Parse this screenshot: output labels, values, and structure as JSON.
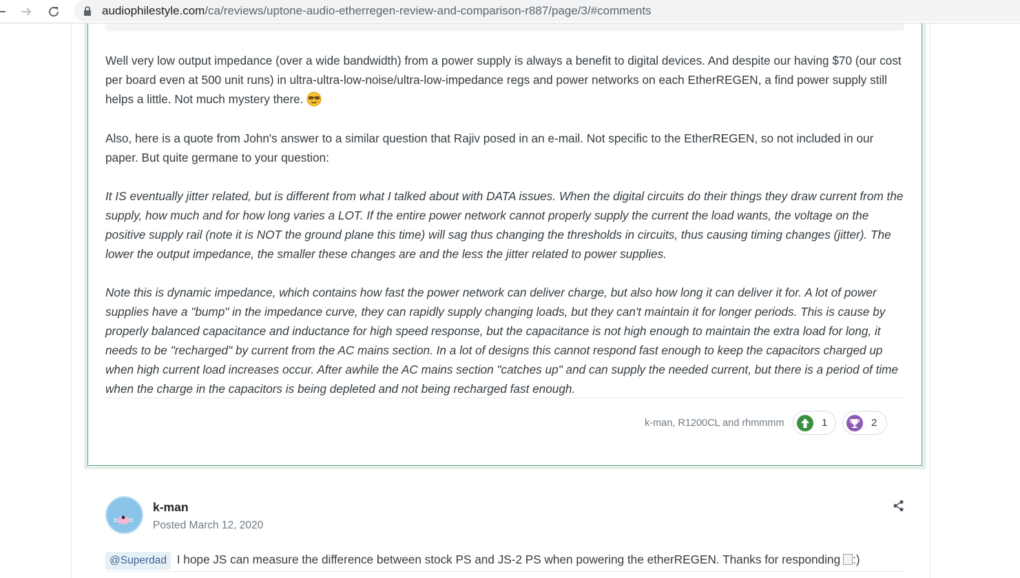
{
  "browser": {
    "url_domain": "audiophilestyle.com",
    "url_path": "/ca/reviews/uptone-audio-etherregen-review-and-comparison-r887/page/3/#comments"
  },
  "post": {
    "paragraph1": "Well very low output impedance (over a wide bandwidth) from a power supply is always a benefit to digital devices.  And despite our having $70 (our cost per board even at 500 unit runs) in ultra-ultra-low-noise/ultra-low-impedance regs and power networks on each EtherREGEN, a find power supply still helps a little.  Not much mystery there.",
    "paragraph2": "Also, here is a quote from John's answer to a similar question that Rajiv posed in an e-mail. Not specific to the EtherREGEN, so not included in our paper.  But quite germane to your question:",
    "quote1": "It IS eventually jitter related, but is different from what I talked about with DATA issues. When the digital circuits do their things they draw current from the supply, how much and for how long varies a LOT. If the entire power network cannot properly supply the current the load wants, the voltage on the positive supply rail (note it is NOT the ground plane this time) will sag thus changing the thresholds in circuits, thus causing timing changes (jitter). The lower the output impedance, the smaller these changes are and the less the jitter related to power supplies.",
    "quote2": "Note this is dynamic impedance, which contains how fast the power network can deliver charge, but also how long it can deliver it for. A lot of power supplies have a \"bump\" in the impedance curve, they can rapidly supply changing loads, but they can't maintain it for longer periods. This is cause by properly balanced capacitance and inductance for high speed response, but the capacitance is not high enough to maintain the extra load for long, it needs to be \"recharged\" by current from the AC mains section. In a lot of designs this cannot respond fast enough to keep the capacitors charged up when high current load increases occur. After awhile the AC mains section \"catches up\" and can supply the needed current, but there is a period of time when the charge in the capacitors is being depleted and not being recharged fast enough.",
    "reactions": {
      "names": "k-man, R1200CL and rhmmmm",
      "upvote_count": "1",
      "trophy_count": "2"
    }
  },
  "next_comment": {
    "author": "k-man",
    "date": "Posted March 12, 2020",
    "mention": "@Superdad",
    "text": "I hope JS can measure the difference between stock PS and JS-2 PS when powering the etherREGEN. Thanks for responding",
    "img_alt": ":)"
  }
}
